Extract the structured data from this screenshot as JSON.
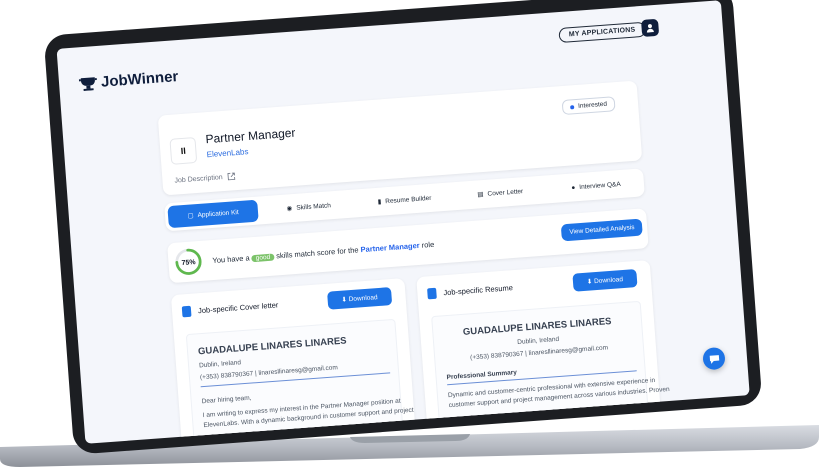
{
  "app": {
    "name": "JobWinner"
  },
  "header": {
    "my_applications_label": "MY APPLICATIONS"
  },
  "job": {
    "logo_text": "II",
    "title": "Partner Manager",
    "company": "ElevenLabs",
    "description_label": "Job Description",
    "status": "Interested"
  },
  "tabs": [
    {
      "label": "Application Kit",
      "active": true
    },
    {
      "label": "Skills Match",
      "active": false
    },
    {
      "label": "Resume Builder",
      "active": false
    },
    {
      "label": "Cover Letter",
      "active": false
    },
    {
      "label": "Interview Q&A",
      "active": false
    }
  ],
  "match": {
    "score": "75%",
    "percent": 75,
    "prefix": "You have a",
    "badge": "good",
    "middle": "skills match score for the",
    "role": "Partner Manager",
    "suffix": "role",
    "analysis_button": "View Detailed Analysis"
  },
  "cover_letter": {
    "title": "Job-specific Cover letter",
    "download_label": "Download",
    "name": "GUADALUPE LINARES LINARES",
    "location": "Dublin, Ireland",
    "contact": "(+353) 838790367 | linaresllinaresg@gmail.com",
    "greeting": "Dear hiring team,",
    "body_line1": "I am writing to express my interest in the Partner Manager position at",
    "body_line2": "ElevenLabs. With a dynamic background in customer support and project"
  },
  "resume": {
    "title": "Job-specific Resume",
    "download_label": "Download",
    "name": "GUADALUPE LINARES LINARES",
    "location": "Dublin, Ireland",
    "contact": "(+353) 838790367 | linaresllinaresg@gmail.com",
    "section": "Professional Summary",
    "body_line1": "Dynamic and customer-centric professional with extensive experience in",
    "body_line2": "customer support and project management across various industries. Proven"
  },
  "colors": {
    "accent": "#1e74e6",
    "good": "#7cc36a",
    "brand_dark": "#0f1e3c"
  }
}
